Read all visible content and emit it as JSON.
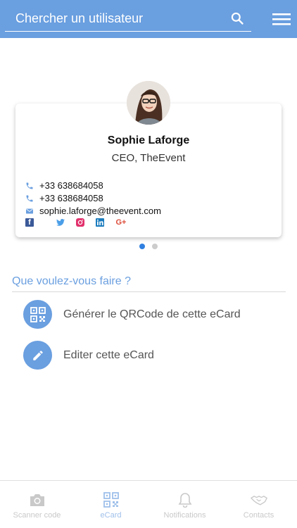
{
  "search": {
    "placeholder": "Chercher un utilisateur"
  },
  "profile": {
    "name": "Sophie Laforge",
    "role": "CEO, TheEvent",
    "phone1": "+33 638684058",
    "phone2": "+33 638684058",
    "email": "sophie.laforge@theevent.com"
  },
  "socials": {
    "facebook": "f",
    "googleplus": "G+"
  },
  "actions": {
    "title": "Que voulez-vous faire ?",
    "qrcode": "Générer le QRCode de cette eCard",
    "edit": "Editer cette eCard"
  },
  "nav": [
    {
      "label": "Scanner code",
      "icon": "camera-icon"
    },
    {
      "label": "eCard",
      "icon": "qrcode-icon",
      "active": true
    },
    {
      "label": "Notifications",
      "icon": "bell-icon"
    },
    {
      "label": "Contacts",
      "icon": "handshake-icon"
    }
  ],
  "colors": {
    "accent": "#6a9fe0",
    "accent_light": "#9fc0ea",
    "muted": "#c9c9c9"
  }
}
